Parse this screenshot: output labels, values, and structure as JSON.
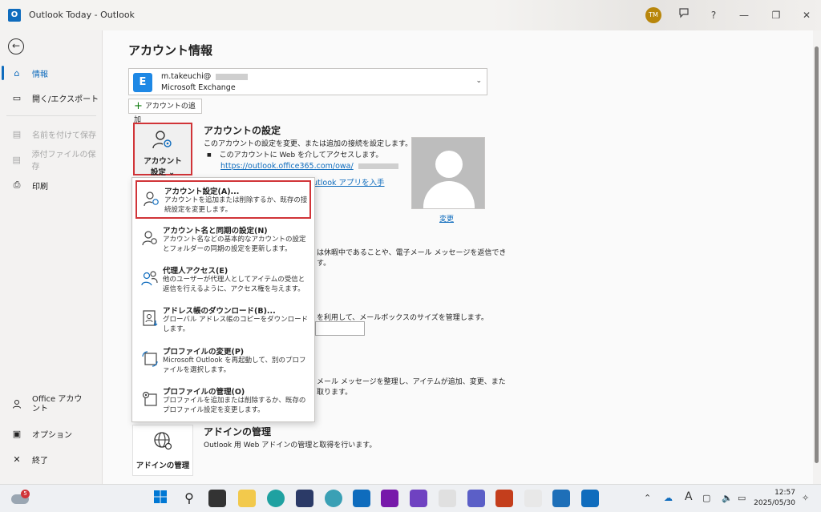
{
  "window": {
    "title": "Outlook Today  -  Outlook",
    "app_icon": "O",
    "user_initials": "TM",
    "buttons": {
      "feedback_icon": "feedback-icon",
      "help": "?",
      "minimize": "—",
      "restore": "❐",
      "close": "✕"
    }
  },
  "sidebar": {
    "back_glyph": "←",
    "items": [
      {
        "label": "情報",
        "icon": "⌂",
        "state": "active"
      },
      {
        "label": "開く/エクスポート",
        "icon": "▭",
        "state": "normal"
      },
      {
        "label": "名前を付けて保存",
        "icon": "▤",
        "state": "disabled"
      },
      {
        "label": "添付ファイルの保存",
        "icon": "▤",
        "state": "disabled"
      },
      {
        "label": "印刷",
        "icon": "⎙",
        "state": "normal"
      }
    ],
    "bottom_items": [
      {
        "label": "Office アカウント",
        "icon": "👤"
      },
      {
        "label": "オプション",
        "icon": "▣"
      },
      {
        "label": "終了",
        "icon": "✕"
      }
    ]
  },
  "main": {
    "page_title": "アカウント情報",
    "account": {
      "email": "m.takeuchi@",
      "type": "Microsoft Exchange",
      "icon_letter": "E"
    },
    "add_account_label": "アカウントの追加",
    "account_settings": {
      "tile_label_line1": "アカウント",
      "tile_label_line2": "設定",
      "title": "アカウントの設定",
      "description": "このアカウントの設定を変更、または追加の接続を設定します。",
      "bullet": "このアカウントに Web を介してアクセスします。",
      "link": "https://outlook.office365.com/owa/",
      "link2": "utlook アプリを入手"
    },
    "change_photo_label": "変更",
    "partial_text_1": "は休暇中であることや、電子メール メッセージを返信でき",
    "partial_text_1b": "す。",
    "partial_text_2": "を利用して、メールボックスのサイズを管理します。",
    "partial_text_3": "メール メッセージを整理し、アイテムが追加、変更、また",
    "partial_text_3b": "取ります。",
    "addin": {
      "tile_label": "アドインの管理",
      "title": "アドインの管理",
      "description": "Outlook 用 Web アドインの管理と取得を行います。"
    }
  },
  "menu": {
    "items": [
      {
        "title": "アカウント設定(A)...",
        "desc": "アカウントを追加または削除するか、既存の接続設定を変更します。",
        "icon": "👤"
      },
      {
        "title": "アカウント名と同期の設定(N)",
        "desc": "アカウント名などの基本的なアカウントの設定とフォルダーの同期の設定を更新します。",
        "icon": "👤"
      },
      {
        "title": "代理人アクセス(E)",
        "desc": "他のユーザーが代理人としてアイテムの受信と返信を行えるように、アクセス権を与えます。",
        "icon": "👥"
      },
      {
        "title": "アドレス帳のダウンロード(B)...",
        "desc": "グローバル アドレス帳のコピーをダウンロードします。",
        "icon": "📇"
      },
      {
        "title": "プロファイルの変更(P)",
        "desc": "Microsoft Outlook を再起動して、別のプロファイルを選択します。",
        "icon": "🔁"
      },
      {
        "title": "プロファイルの管理(O)",
        "desc": "プロファイルを追加または削除するか、既存のプロファイル設定を変更します。",
        "icon": "⚙"
      }
    ]
  },
  "taskbar": {
    "weather_badge": "5",
    "time": "12:57",
    "date": "2025/05/30",
    "tray_font_icon": "A"
  }
}
